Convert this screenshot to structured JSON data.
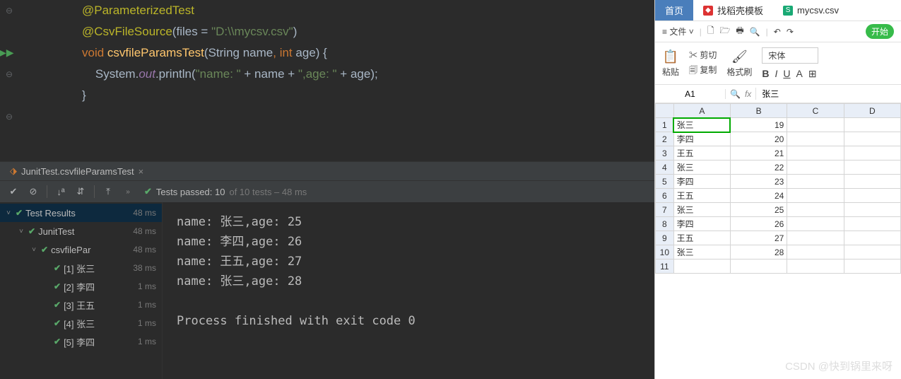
{
  "code": {
    "line1_ann": "@ParameterizedTest",
    "line2_ann": "@CsvFileSource",
    "line2_arg": "files = ",
    "line2_str": "\"D:\\\\mycsv.csv\"",
    "line3_kw_void": "void",
    "line3_method": "csvfileParamsTest",
    "line3_params_a": "String name",
    "line3_params_b_kw": "int",
    "line3_params_b_name": "age",
    "line4_prefix": "System.",
    "line4_out": "out",
    "line4_call": ".println(",
    "line4_str1": "\"name: \"",
    "line4_plus": " + name + ",
    "line4_str2": "\",age: \"",
    "line4_plus2": " + age);",
    "line5_brace": "}"
  },
  "run_tab": {
    "label": "JunitTest.csvfileParamsTest",
    "close": "×"
  },
  "toolstrip_status": {
    "tick": "✔",
    "prefix": "Tests passed: 10",
    "suffix": " of 10 tests – 48 ms"
  },
  "tree": [
    {
      "indent": 0,
      "chev": "˅",
      "label": "Test Results",
      "time": "48 ms",
      "sel": true
    },
    {
      "indent": 1,
      "chev": "˅",
      "label": "JunitTest",
      "time": "48 ms"
    },
    {
      "indent": 2,
      "chev": "˅",
      "label": "csvfilePar",
      "time": "48 ms"
    },
    {
      "indent": 3,
      "chev": "",
      "label": "[1] 张三",
      "time": "38 ms"
    },
    {
      "indent": 3,
      "chev": "",
      "label": "[2] 李四",
      "time": "1 ms"
    },
    {
      "indent": 3,
      "chev": "",
      "label": "[3] 王五",
      "time": "1 ms"
    },
    {
      "indent": 3,
      "chev": "",
      "label": "[4] 张三",
      "time": "1 ms"
    },
    {
      "indent": 3,
      "chev": "",
      "label": "[5] 李四",
      "time": "1 ms"
    }
  ],
  "console": [
    "name: 张三,age: 25",
    "name: 李四,age: 26",
    "name: 王五,age: 27",
    "name: 张三,age: 28",
    "",
    "Process finished with exit code 0"
  ],
  "ss": {
    "tabs": [
      {
        "label": "首页",
        "active": true
      },
      {
        "label": "找稻壳模板",
        "icon": "◆",
        "iconbg": "#d33"
      },
      {
        "label": "mycsv.csv",
        "icon": "S",
        "iconbg": "#19a974"
      }
    ],
    "menu": {
      "file": "文件",
      "start": "开始"
    },
    "tools": {
      "paste": "粘贴",
      "cut": "剪切",
      "copy": "复制",
      "format": "格式刷",
      "font": "宋体"
    },
    "cellref": "A1",
    "cellval": "张三",
    "cols": [
      "A",
      "B",
      "C",
      "D"
    ],
    "chart_data": {
      "type": "table",
      "rows": [
        {
          "n": 1,
          "a": "张三",
          "b": 19
        },
        {
          "n": 2,
          "a": "李四",
          "b": 20
        },
        {
          "n": 3,
          "a": "王五",
          "b": 21
        },
        {
          "n": 4,
          "a": "张三",
          "b": 22
        },
        {
          "n": 5,
          "a": "李四",
          "b": 23
        },
        {
          "n": 6,
          "a": "王五",
          "b": 24
        },
        {
          "n": 7,
          "a": "张三",
          "b": 25
        },
        {
          "n": 8,
          "a": "李四",
          "b": 26
        },
        {
          "n": 9,
          "a": "王五",
          "b": 27
        },
        {
          "n": 10,
          "a": "张三",
          "b": 28
        }
      ]
    }
  },
  "watermark": "CSDN @快到锅里来呀"
}
